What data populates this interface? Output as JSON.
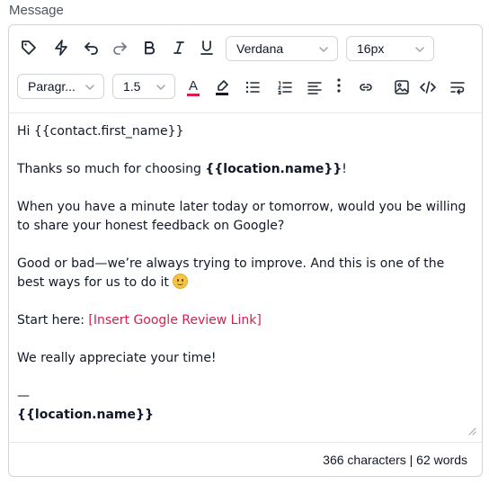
{
  "field": {
    "label": "Message"
  },
  "toolbar": {
    "font_family": "Verdana",
    "font_size": "16px",
    "block_type": "Paragr...",
    "line_height": "1.5",
    "text_color_letter": "A",
    "text_color": "#d61f4e",
    "highlight_color": "#111827",
    "icons": [
      "tag-icon",
      "lightning-icon",
      "undo-icon",
      "redo-icon",
      "bold-icon",
      "italic-icon",
      "underline-icon",
      "text-color-icon",
      "highlight-icon",
      "bullet-list-icon",
      "numbered-list-icon",
      "align-icon",
      "more-icon",
      "link-icon",
      "image-icon",
      "code-icon",
      "text-wrap-icon"
    ]
  },
  "message": {
    "greeting": "Hi {{contact.first_name}}",
    "thanks_prefix": "Thanks so much for choosing ",
    "thanks_bold": "{{location.name}}",
    "thanks_suffix": "!",
    "request_line1": "When you have a minute later today or tomorrow, would you be willing",
    "request_line2": "to share your honest feedback on Google?",
    "improve_line1": "Good or bad—we’re always trying to improve. And this is one of the",
    "improve_line2": "best ways for us to do it ",
    "start_prefix": "Start here: ",
    "start_link": "[Insert Google Review Link]",
    "appreciate": "We really appreciate your time!",
    "dash": "—",
    "signature": "{{location.name}}"
  },
  "footer": {
    "counts": "366 characters | 62 words"
  },
  "colors": {
    "link": "#d61f4e",
    "border": "#d1d5db"
  }
}
